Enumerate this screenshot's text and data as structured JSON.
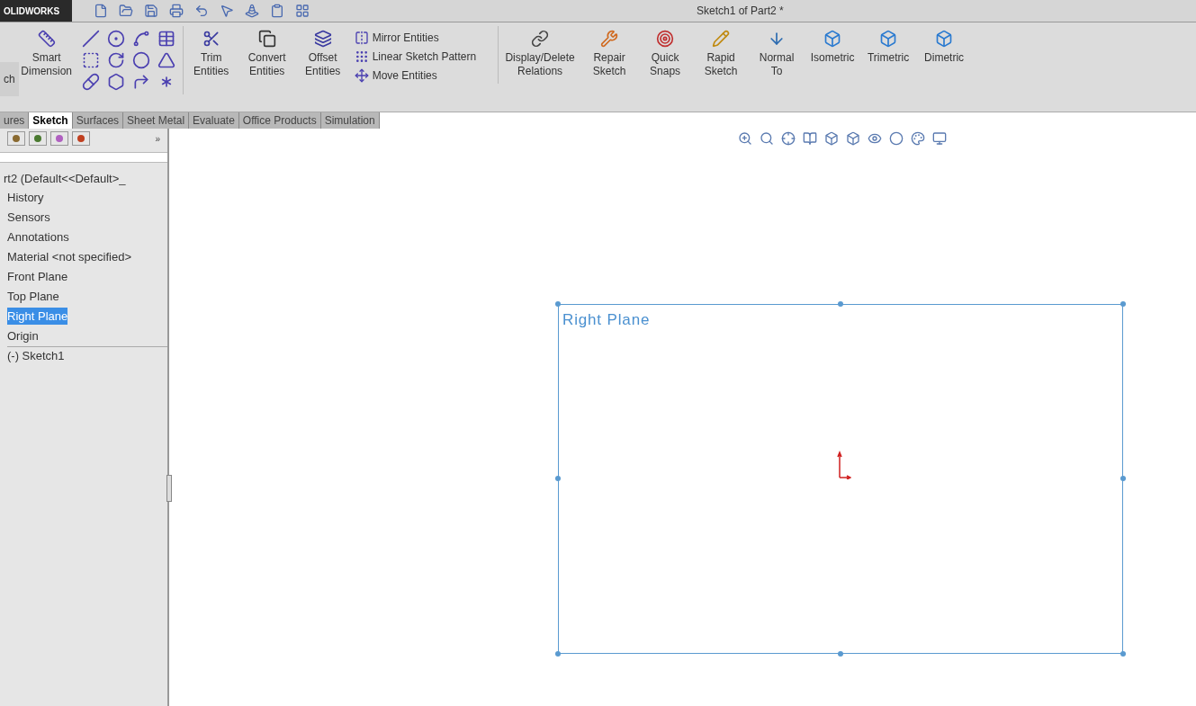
{
  "window": {
    "logo": "OLIDWORKS",
    "title": "Sketch1 of Part2 *"
  },
  "ribbon": {
    "cut_button": "ch",
    "buttons": [
      {
        "kind": "large",
        "label": "Smart Dimension"
      },
      {
        "kind": "grid"
      },
      {
        "kind": "large",
        "label": "Trim Entities"
      },
      {
        "kind": "large",
        "label": "Convert Entities"
      },
      {
        "kind": "large",
        "label": "Offset Entities"
      },
      {
        "kind": "list",
        "items": [
          "Mirror Entities",
          "Linear Sketch Pattern",
          "Move Entities"
        ]
      },
      {
        "kind": "large",
        "label": "Display/Delete Relations"
      },
      {
        "kind": "large",
        "label": "Repair Sketch"
      },
      {
        "kind": "large",
        "label": "Quick Snaps"
      },
      {
        "kind": "large",
        "label": "Rapid Sketch"
      },
      {
        "kind": "large",
        "label": "Normal To"
      },
      {
        "kind": "large",
        "label": "Isometric"
      },
      {
        "kind": "large",
        "label": "Trimetric"
      },
      {
        "kind": "large",
        "label": "Dimetric"
      }
    ]
  },
  "tabs": [
    {
      "label": "ures",
      "selected": false
    },
    {
      "label": "Sketch",
      "selected": true
    },
    {
      "label": "Surfaces",
      "selected": false
    },
    {
      "label": "Sheet Metal",
      "selected": false
    },
    {
      "label": "Evaluate",
      "selected": false
    },
    {
      "label": "Office Products",
      "selected": false
    },
    {
      "label": "Simulation",
      "selected": false
    }
  ],
  "feature_tree": {
    "expand_glyph": "»",
    "root": "rt2  (Default<<Default>_",
    "items": [
      {
        "label": "History",
        "selected": false
      },
      {
        "label": "Sensors",
        "selected": false
      },
      {
        "label": "Annotations",
        "selected": false
      },
      {
        "label": "Material <not specified>",
        "selected": false
      },
      {
        "label": "Front Plane",
        "selected": false
      },
      {
        "label": "Top Plane",
        "selected": false
      },
      {
        "label": "Right Plane",
        "selected": true
      },
      {
        "label": "Origin",
        "selected": false
      },
      {
        "label": "(-) Sketch1",
        "selected": false
      }
    ]
  },
  "canvas": {
    "plane_label": "Right Plane"
  }
}
